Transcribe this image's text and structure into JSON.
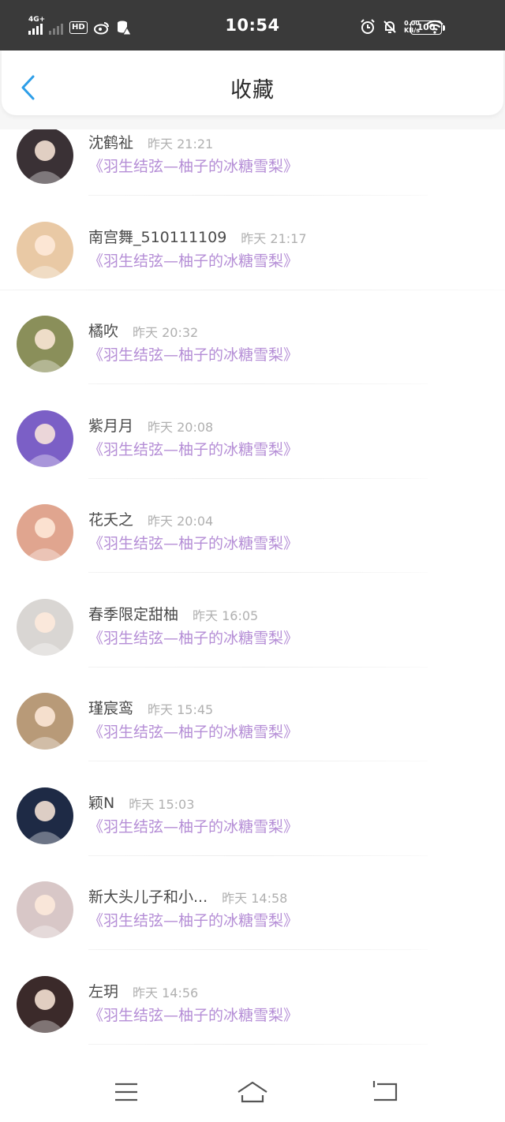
{
  "status_bar": {
    "network": "4G+",
    "hd": "HD",
    "time": "10:54",
    "speed_top": "0.00",
    "speed_bottom": "KB/s",
    "battery": "100"
  },
  "header": {
    "title": "收藏"
  },
  "favorites": [
    {
      "name": "沈鹤祉",
      "time": "昨天 21:21",
      "book": "《羽生结弦—柚子的冰糖雪梨》",
      "avatar_bg": "#3a3135"
    },
    {
      "name": "南宫舞_510111109",
      "time": "昨天 21:17",
      "book": "《羽生结弦—柚子的冰糖雪梨》",
      "avatar_bg": "#e9c9a5"
    },
    {
      "name": "橘吹",
      "time": "昨天 20:32",
      "book": "《羽生结弦—柚子的冰糖雪梨》",
      "avatar_bg": "#8a8f5a"
    },
    {
      "name": "紫月月",
      "time": "昨天 20:08",
      "book": "《羽生结弦—柚子的冰糖雪梨》",
      "avatar_bg": "#7b5fc6"
    },
    {
      "name": "花夭之",
      "time": "昨天 20:04",
      "book": "《羽生结弦—柚子的冰糖雪梨》",
      "avatar_bg": "#e0a58f"
    },
    {
      "name": "春季限定甜柚",
      "time": "昨天 16:05",
      "book": "《羽生结弦—柚子的冰糖雪梨》",
      "avatar_bg": "#d9d6d3"
    },
    {
      "name": "瑾宸鸾",
      "time": "昨天 15:45",
      "book": "《羽生结弦—柚子的冰糖雪梨》",
      "avatar_bg": "#b89a78"
    },
    {
      "name": "颖N",
      "time": "昨天 15:03",
      "book": "《羽生结弦—柚子的冰糖雪梨》",
      "avatar_bg": "#1e2a45"
    },
    {
      "name": "新大头儿子和小...",
      "time": "昨天 14:58",
      "book": "《羽生结弦—柚子的冰糖雪梨》",
      "avatar_bg": "#d8c7c7"
    },
    {
      "name": "左玥",
      "time": "昨天 14:56",
      "book": "《羽生结弦—柚子的冰糖雪梨》",
      "avatar_bg": "#3b2a2a"
    }
  ],
  "nav": {
    "icons": [
      "menu-icon",
      "home-icon",
      "back-icon"
    ]
  },
  "colors": {
    "accent_blue": "#2d9ee8",
    "book_purple": "#b58ed6",
    "status_bar_bg": "#3a3a3a"
  }
}
